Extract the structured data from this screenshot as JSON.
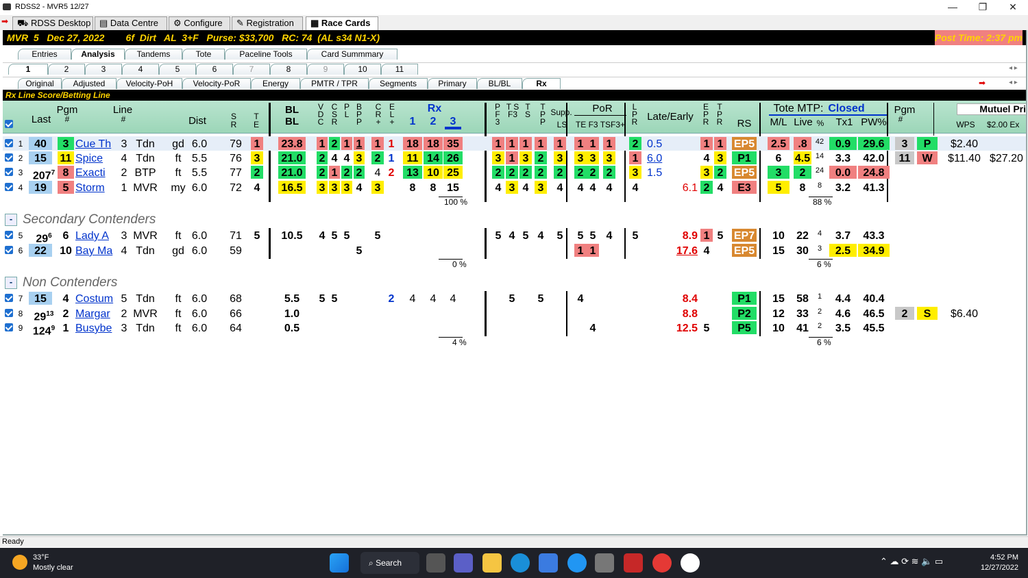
{
  "window": {
    "title": "RDSS2 - MVR5  12/27",
    "min": "—",
    "max": "❐",
    "close": "✕"
  },
  "app_tabs": [
    "RDSS Desktop",
    "Data Centre",
    "Configure",
    "Registration",
    "Race Cards"
  ],
  "header": {
    "left": "MVR  5   Dec 27, 2022        6f  Dirt   AL  3+F   Purse: $33,700   RC: 74  (AL s34 N1-X)",
    "right": "Post Time:  2:37 pm"
  },
  "tabs1": [
    "Entries",
    "Analysis",
    "Tandems",
    "Tote",
    "Paceline Tools",
    "Card Summmary"
  ],
  "tabs2": [
    "1",
    "2",
    "3",
    "4",
    "5",
    "6",
    "7",
    "8",
    "9",
    "10",
    "11"
  ],
  "tabs3": [
    "Original",
    "Adjusted",
    "Velocity-PoH",
    "Velocity-PoR",
    "Energy",
    "PMTR / TPR",
    "Segments",
    "Primary",
    "BL/BL",
    "Rx"
  ],
  "subtitle": "Rx Line Score/Betting Line",
  "colhdr": {
    "last": "Last",
    "pgm": "Pgm",
    "pgmhash": "#",
    "line": "Line",
    "linehash": "#",
    "dist": "Dist",
    "sr1": "S",
    "sr2": "R",
    "te1": "T",
    "te2": "E",
    "bl1": "BL",
    "bl2": "BL",
    "vd": "V D C",
    "csr": "C S R",
    "pl": "P L",
    "bp": "B P P",
    "cr": "C R +",
    "el": "E L +",
    "rx": "Rx",
    "rx1": "1",
    "rx2": "2",
    "rx3": "3",
    "pf": "P F 3",
    "ts": "T S F3",
    "t": "T S",
    "tp": "T P P",
    "supp": "Supp.",
    "ls": "LS",
    "por": "PoR",
    "te": "TE F3 TSF3+",
    "lpr": "L P R",
    "late": "Late/Early",
    "epr": "E P R",
    "tpr": "T P R",
    "rs": "RS",
    "tote": "Tote MTP:",
    "closed": "Closed",
    "ml": "M/L",
    "live": "Live",
    "pctl": "%",
    "tx1": "Tx1",
    "pw": "PW%",
    "pgm2": "Pgm",
    "pgm2h": "#",
    "mutuel": "Mutuel Pri",
    "wps": "WPS",
    "ex": "$2.00 Ex"
  },
  "sections": {
    "secondary": "Secondary Contenders",
    "non": "Non Contenders",
    "minus": "-"
  },
  "rows": [
    {
      "n": "1",
      "last": "40",
      "pgm": "3",
      "name": "Cue Th",
      "line": "3",
      "trk": "Tdn",
      "cond": "gd",
      "dist": "6.0",
      "sr": "79",
      "te": "1",
      "bl": "23.8",
      "v": [
        "1",
        "2",
        "1",
        "1"
      ],
      "cr": "1",
      "el": "1",
      "rx": [
        "18",
        "18",
        "35"
      ],
      "pf": [
        "1",
        "1",
        "1",
        "1"
      ],
      "supp": "1",
      "por": [
        "1",
        "1",
        "1"
      ],
      "lpr": "2",
      "late": "0.5",
      "epr": "1",
      "tpr": "1",
      "rs": "EP5",
      "ml": "2.5",
      "live": ".8",
      "pct": "42",
      "tx1": "0.9",
      "pw": "29.6",
      "pgm2": "3",
      "fin": "P",
      "wps": "$2.40",
      "ex": ""
    },
    {
      "n": "2",
      "last": "15",
      "pgm": "11",
      "name": "Spice",
      "line": "4",
      "trk": "Tdn",
      "cond": "ft",
      "dist": "5.5",
      "sr": "76",
      "te": "3",
      "bl": "21.0",
      "v": [
        "2",
        "4",
        "4",
        "3"
      ],
      "cr": "2",
      "el": "1",
      "rx": [
        "11",
        "14",
        "26"
      ],
      "pf": [
        "3",
        "1",
        "3",
        "2"
      ],
      "supp": "3",
      "por": [
        "3",
        "3",
        "3"
      ],
      "lpr": "1",
      "late": "6.0",
      "epr": "4",
      "tpr": "3",
      "rs": "P1",
      "ml": "6",
      "live": "4.5",
      "pct": "14",
      "tx1": "3.3",
      "pw": "42.0",
      "pgm2": "11",
      "fin": "W",
      "wps": "$11.40",
      "ex": "$27.20"
    },
    {
      "n": "3",
      "last": "207",
      "lastsup": "7",
      "pgm": "8",
      "name": "Exacti",
      "line": "2",
      "trk": "BTP",
      "cond": "ft",
      "dist": "5.5",
      "sr": "77",
      "te": "2",
      "bl": "21.0",
      "v": [
        "2",
        "1",
        "2",
        "2"
      ],
      "cr": "4",
      "el": "2",
      "rx": [
        "13",
        "10",
        "25"
      ],
      "pf": [
        "2",
        "2",
        "2",
        "2"
      ],
      "supp": "2",
      "por": [
        "2",
        "2",
        "2"
      ],
      "lpr": "3",
      "late": "1.5",
      "epr": "3",
      "tpr": "2",
      "rs": "EP5",
      "ml": "3",
      "live": "2",
      "pct": "24",
      "tx1": "0.0",
      "pw": "24.8"
    },
    {
      "n": "4",
      "last": "19",
      "pgm": "5",
      "name": "Storm",
      "line": "1",
      "trk": "MVR",
      "cond": "my",
      "dist": "6.0",
      "sr": "72",
      "te": "4",
      "bl": "16.5",
      "v": [
        "3",
        "3",
        "3",
        "4"
      ],
      "cr": "3",
      "el": "",
      "rx": [
        "8",
        "8",
        "15"
      ],
      "pf": [
        "4",
        "3",
        "4",
        "3"
      ],
      "supp": "4",
      "por": [
        "4",
        "4",
        "4"
      ],
      "lpr": "4",
      "late": "6.1",
      "epr": "2",
      "tpr": "4",
      "rs": "E3",
      "ml": "5",
      "live": "8",
      "pct": "8",
      "tx1": "3.2",
      "pw": "41.3"
    },
    {
      "n": "5",
      "last": "29",
      "lastsup": "6",
      "pgm": "6",
      "name": "Lady A",
      "line": "3",
      "trk": "MVR",
      "cond": "ft",
      "dist": "6.0",
      "sr": "71",
      "te": "5",
      "bl": "10.5",
      "v": [
        "4",
        "5",
        "5",
        ""
      ],
      "cr": "5",
      "el": "",
      "rx": [
        "",
        "",
        ""
      ],
      "pf": [
        "5",
        "4",
        "5",
        "4"
      ],
      "supp": "5",
      "por": [
        "5",
        "5",
        "4"
      ],
      "lpr": "5",
      "late": "8.9",
      "epr": "1",
      "tpr": "5",
      "rs": "EP7",
      "ml": "10",
      "live": "22",
      "pct": "4",
      "tx1": "3.7",
      "pw": "43.3"
    },
    {
      "n": "6",
      "last": "22",
      "pgm": "10",
      "name": "Bay Ma",
      "line": "4",
      "trk": "Tdn",
      "cond": "gd",
      "dist": "6.0",
      "sr": "59",
      "te": "",
      "bl": "",
      "v": [
        "",
        "",
        "",
        "5"
      ],
      "cr": "",
      "el": "",
      "rx": [
        "",
        "",
        ""
      ],
      "pf": [
        "",
        "",
        "",
        ""
      ],
      "supp": "",
      "por": [
        "1",
        "1",
        ""
      ],
      "lpr": "",
      "late": "17.6",
      "epr": "4",
      "tpr": "",
      "rs": "EP5",
      "ml": "15",
      "live": "30",
      "pct": "3",
      "tx1": "2.5",
      "pw": "34.9"
    },
    {
      "n": "7",
      "last": "15",
      "pgm": "4",
      "name": "Costum",
      "line": "5",
      "trk": "Tdn",
      "cond": "ft",
      "dist": "6.0",
      "sr": "68",
      "te": "",
      "bl": "5.5",
      "v": [
        "5",
        "5",
        "",
        ""
      ],
      "cr": "",
      "el": "2",
      "rx": [
        "4",
        "4",
        "4"
      ],
      "pf": [
        "",
        "5",
        "",
        "5"
      ],
      "supp": "",
      "por": [
        "4",
        "",
        ""
      ],
      "lpr": "",
      "late": "8.4",
      "epr": "",
      "tpr": "",
      "rs": "P1",
      "ml": "15",
      "live": "58",
      "pct": "1",
      "tx1": "4.4",
      "pw": "40.4"
    },
    {
      "n": "8",
      "last": "29",
      "lastsup": "13",
      "pgm": "2",
      "name": "Margar",
      "line": "2",
      "trk": "MVR",
      "cond": "ft",
      "dist": "6.0",
      "sr": "66",
      "te": "",
      "bl": "1.0",
      "v": [
        "",
        "",
        "",
        ""
      ],
      "cr": "",
      "el": "",
      "rx": [
        "",
        "",
        ""
      ],
      "pf": [
        "",
        "",
        "",
        ""
      ],
      "supp": "",
      "por": [
        "",
        "",
        ""
      ],
      "lpr": "",
      "late": "8.8",
      "epr": "",
      "tpr": "",
      "rs": "P2",
      "ml": "12",
      "live": "33",
      "pct": "2",
      "tx1": "4.6",
      "pw": "46.5",
      "pgm2": "2",
      "fin": "S",
      "wps": "$6.40"
    },
    {
      "n": "9",
      "last": "124",
      "lastsup": "9",
      "pgm": "1",
      "name": "Busybe",
      "line": "3",
      "trk": "Tdn",
      "cond": "ft",
      "dist": "6.0",
      "sr": "64",
      "te": "",
      "bl": "0.5",
      "v": [
        "",
        "",
        "",
        ""
      ],
      "cr": "",
      "el": "",
      "rx": [
        "",
        "",
        ""
      ],
      "pf": [
        "",
        "",
        "",
        ""
      ],
      "supp": "",
      "por": [
        "",
        "4",
        ""
      ],
      "lpr": "",
      "late": "12.5",
      "epr": "5",
      "tpr": "",
      "rs": "P5",
      "ml": "10",
      "live": "41",
      "pct": "2",
      "tx1": "3.5",
      "pw": "45.5"
    }
  ],
  "totals": {
    "rx1": "100 %",
    "tote1": "88 %",
    "rx2": "0 %",
    "tote2": "6 %",
    "rx3": "4 %",
    "tote3": "6 %"
  },
  "status": "Ready",
  "taskbar": {
    "temp": "33°F",
    "weather": "Mostly clear",
    "search": "Search",
    "time": "4:52 PM",
    "date": "12/27/2022"
  }
}
